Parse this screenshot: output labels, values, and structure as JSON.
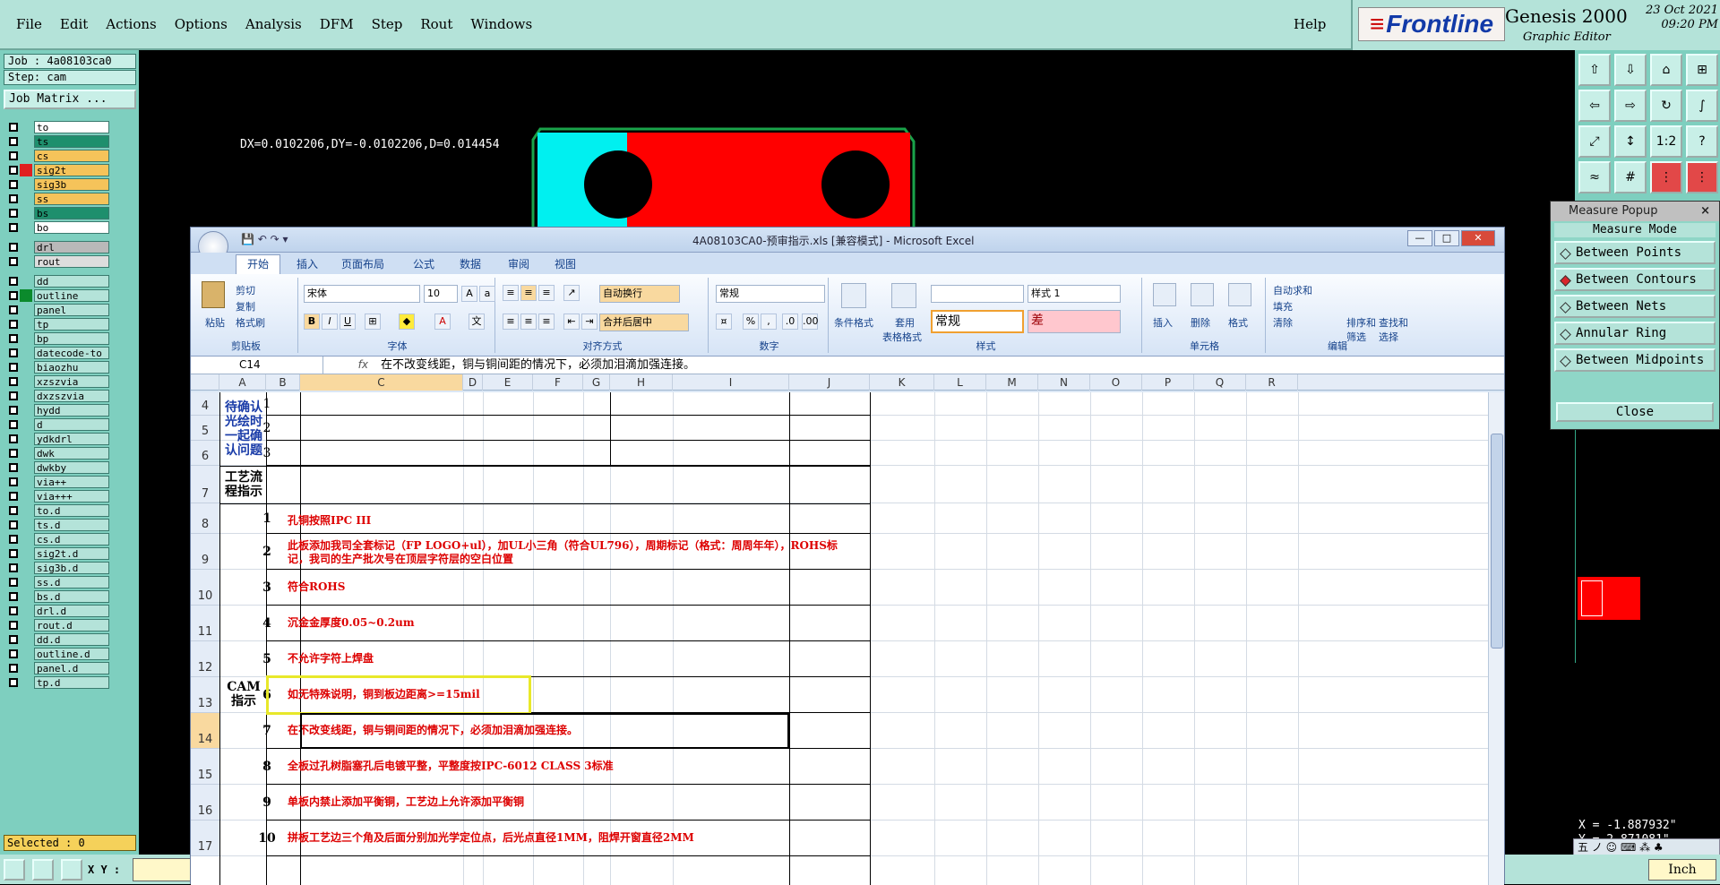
{
  "menu": [
    "File",
    "Edit",
    "Actions",
    "Options",
    "Analysis",
    "DFM",
    "Step",
    "Rout",
    "Windows"
  ],
  "help": "Help",
  "brand": {
    "logo": "Frontline",
    "product": "Genesis 2000",
    "subtitle": "Graphic Editor",
    "date": "23 Oct 2021",
    "time": "09:20 PM"
  },
  "job": {
    "job": "Job : 4a08103ca0",
    "step": "Step: cam",
    "matrix": "Job Matrix ..."
  },
  "layers_a": [
    {
      "name": "to",
      "color": "#ffffff"
    },
    {
      "name": "ts",
      "color": "#1e8f6d"
    },
    {
      "name": "cs",
      "color": "#f5c35a"
    },
    {
      "name": "sig2t",
      "color": "#f5c35a",
      "swatch": "#e02020"
    },
    {
      "name": "sig3b",
      "color": "#f5c35a"
    },
    {
      "name": "ss",
      "color": "#f5c35a"
    },
    {
      "name": "bs",
      "color": "#1e8f6d"
    },
    {
      "name": "bo",
      "color": "#ffffff"
    }
  ],
  "layers_b": [
    {
      "name": "drl",
      "color": "#b9b9b9"
    },
    {
      "name": "rout",
      "color": "#dddddd"
    }
  ],
  "layers_c": [
    {
      "name": "dd",
      "color": "#b4e3d9"
    },
    {
      "name": "outline",
      "color": "#b4e3d9",
      "swatch": "#0b8a2c",
      "dark": true
    },
    {
      "name": "panel",
      "color": "#b4e3d9"
    },
    {
      "name": "tp",
      "color": "#b4e3d9"
    },
    {
      "name": "bp",
      "color": "#b4e3d9"
    },
    {
      "name": "datecode-to",
      "color": "#b4e3d9"
    },
    {
      "name": "biaozhu",
      "color": "#b4e3d9"
    },
    {
      "name": "xzszvia",
      "color": "#b4e3d9"
    },
    {
      "name": "dxzszvia",
      "color": "#b4e3d9"
    },
    {
      "name": "hydd",
      "color": "#b4e3d9"
    },
    {
      "name": "d",
      "color": "#b4e3d9"
    },
    {
      "name": "ydkdrl",
      "color": "#b4e3d9"
    },
    {
      "name": "dwk",
      "color": "#b4e3d9"
    },
    {
      "name": "dwkby",
      "color": "#b4e3d9"
    },
    {
      "name": "via++",
      "color": "#b4e3d9"
    },
    {
      "name": "via+++",
      "color": "#b4e3d9"
    },
    {
      "name": "to.d",
      "color": "#b4e3d9"
    },
    {
      "name": "ts.d",
      "color": "#b4e3d9"
    },
    {
      "name": "cs.d",
      "color": "#b4e3d9"
    },
    {
      "name": "sig2t.d",
      "color": "#b4e3d9"
    },
    {
      "name": "sig3b.d",
      "color": "#b4e3d9"
    },
    {
      "name": "ss.d",
      "color": "#b4e3d9"
    },
    {
      "name": "bs.d",
      "color": "#b4e3d9"
    },
    {
      "name": "drl.d",
      "color": "#b4e3d9"
    },
    {
      "name": "rout.d",
      "color": "#b4e3d9"
    },
    {
      "name": "dd.d",
      "color": "#b4e3d9"
    },
    {
      "name": "outline.d",
      "color": "#b4e3d9"
    },
    {
      "name": "panel.d",
      "color": "#b4e3d9"
    },
    {
      "name": "tp.d",
      "color": "#b4e3d9"
    }
  ],
  "selected": "Selected : 0",
  "xy_label": "X Y :",
  "xy_value": "",
  "unit": "Inch",
  "dx_readout": "DX=0.0102206,DY=-0.0102206,D=0.014454",
  "coords": {
    "x": "X = -1.887932\"",
    "y": "Y = 2.871081\""
  },
  "measure": {
    "title": "Measure Popup",
    "mode": "Measure Mode",
    "options": [
      "Between Points",
      "Between Contours",
      "Between Nets",
      "Annular Ring",
      "Between Midpoints"
    ],
    "active": 1,
    "close": "Close"
  },
  "excel": {
    "title": "4A08103CA0-预审指示.xls  [兼容模式] - Microsoft Excel",
    "tabs": [
      "开始",
      "插入",
      "页面布局",
      "公式",
      "数据",
      "审阅",
      "视图"
    ],
    "ribbon": {
      "paste": "粘贴",
      "cut": "剪切",
      "copy": "复制",
      "format_painter": "格式刷",
      "clipboard": "剪贴板",
      "font_name": "宋体",
      "font_size": "10",
      "font_group": "字体",
      "wrap": "自动换行",
      "merge": "合并后居中",
      "align_group": "对齐方式",
      "num_format": "常规",
      "num_group": "数字",
      "cond": "条件格式",
      "table_fmt1": "套用",
      "table_fmt2": "表格格式",
      "style1": "样式 1",
      "style_normal": "常规",
      "style_bad": "差",
      "style_group": "样式",
      "insert": "插入",
      "delete": "删除",
      "format": "格式",
      "cells_group": "单元格",
      "autosum": "自动求和",
      "fill": "填充",
      "clear": "清除",
      "sort1": "排序和",
      "sort2": "筛选",
      "find1": "查找和",
      "find2": "选择",
      "edit_group": "编辑"
    },
    "namebox": "C14",
    "fx": "fx",
    "formula": "在不改变线距，铜与铜间距的情况下，必须加泪滴加强连接。",
    "columns": [
      "A",
      "B",
      "C",
      "D",
      "E",
      "F",
      "G",
      "H",
      "I",
      "J",
      "K",
      "L",
      "M",
      "N",
      "O",
      "P",
      "Q",
      "R"
    ],
    "rows": [
      "4",
      "5",
      "6",
      "7",
      "8",
      "9",
      "10",
      "11",
      "12",
      "13",
      "14",
      "15",
      "16",
      "17"
    ],
    "a_confirm": "待确认光绘时一起确认问题",
    "a_process": "工艺流程指示",
    "a_cam": "CAM指示",
    "top_nums": [
      "1",
      "2",
      "3"
    ],
    "items": [
      {
        "n": "1",
        "t": "孔铜按照IPC III"
      },
      {
        "n": "2",
        "t": "此板添加我司全套标记（FP LOGO+ul），加UL小三角（符合UL796），周期标记（格式：周周年年），ROHS标记，我司的生产批次号在顶层字符层的空白位置"
      },
      {
        "n": "3",
        "t": "符合ROHS"
      },
      {
        "n": "4",
        "t": "沉金金厚度0.05~0.2um"
      },
      {
        "n": "5",
        "t": "不允许字符上焊盘"
      },
      {
        "n": "6",
        "t": "如无特殊说明，铜到板边距离>=15mil"
      },
      {
        "n": "7",
        "t": "在不改变线距，铜与铜间距的情况下，必须加泪滴加强连接。"
      },
      {
        "n": "8",
        "t": "全板过孔树脂塞孔后电镀平整，平整度按IPC-6012 CLASS 3标准"
      },
      {
        "n": "9",
        "t": "单板内禁止添加平衡铜，工艺边上允许添加平衡铜"
      },
      {
        "n": "10",
        "t": "拼板工艺边三个角及后面分别加光学定位点，后光点直径1MM，阻焊开窗直径2MM"
      }
    ]
  },
  "ime": "五 ノ ☺ ⌨ ⁂ ♣"
}
